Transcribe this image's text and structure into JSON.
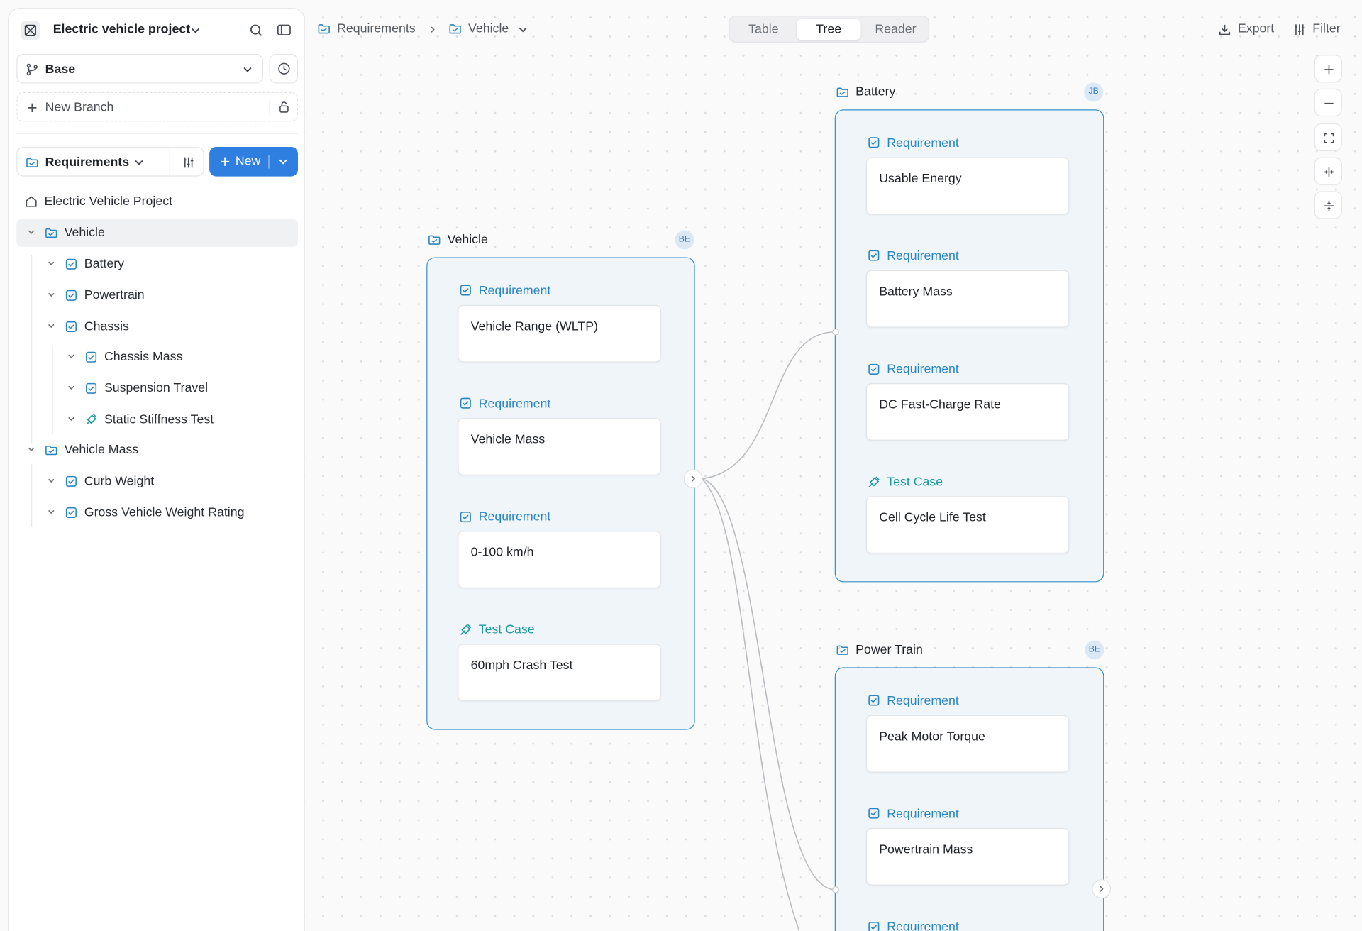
{
  "project": {
    "name": "Electric vehicle project"
  },
  "branch": {
    "current": "Base",
    "new_branch_label": "New Branch"
  },
  "module": {
    "current": "Requirements",
    "new_button_label": "New"
  },
  "tree": [
    {
      "label": "Electric Vehicle Project",
      "icon": "home-icon"
    },
    {
      "label": "Vehicle",
      "icon": "folder-icon",
      "selected": true
    },
    {
      "label": "Battery",
      "icon": "requirement-icon"
    },
    {
      "label": "Powertrain",
      "icon": "requirement-icon"
    },
    {
      "label": "Chassis",
      "icon": "requirement-icon"
    },
    {
      "label": "Chassis Mass",
      "icon": "requirement-icon"
    },
    {
      "label": "Suspension Travel",
      "icon": "requirement-icon"
    },
    {
      "label": "Static Stiffness Test",
      "icon": "test-case-icon"
    },
    {
      "label": "Vehicle Mass",
      "icon": "folder-icon"
    },
    {
      "label": "Curb Weight",
      "icon": "requirement-icon"
    },
    {
      "label": "Gross Vehicle Weight Rating",
      "icon": "requirement-icon"
    }
  ],
  "breadcrumb": [
    "Requirements",
    "Vehicle"
  ],
  "views": [
    "Table",
    "Tree",
    "Reader"
  ],
  "active_view": "Tree",
  "actions": {
    "export": "Export",
    "filter": "Filter"
  },
  "groups": {
    "vehicle": {
      "title": "Vehicle",
      "avatar": "BE",
      "nodes": [
        {
          "type": "Requirement",
          "title": "Vehicle Range (WLTP)"
        },
        {
          "type": "Requirement",
          "title": "Vehicle Mass"
        },
        {
          "type": "Requirement",
          "title": "0-100 km/h"
        },
        {
          "type": "Test Case",
          "title": "60mph Crash Test"
        }
      ]
    },
    "battery": {
      "title": "Battery",
      "avatar": "JB",
      "nodes": [
        {
          "type": "Requirement",
          "title": "Usable Energy"
        },
        {
          "type": "Requirement",
          "title": "Battery Mass"
        },
        {
          "type": "Requirement",
          "title": "DC Fast-Charge Rate"
        },
        {
          "type": "Test Case",
          "title": "Cell Cycle Life Test"
        }
      ]
    },
    "powertrain": {
      "title": "Power Train",
      "avatar": "BE",
      "nodes": [
        {
          "type": "Requirement",
          "title": "Peak Motor Torque"
        },
        {
          "type": "Requirement",
          "title": "Powertrain Mass"
        },
        {
          "type": "Requirement",
          "title": ""
        }
      ]
    }
  },
  "colors": {
    "accent": "#2f7fe0",
    "group_border": "#3a8fc9",
    "requirement": "#2a86c2",
    "test_case": "#1a9aa0"
  }
}
